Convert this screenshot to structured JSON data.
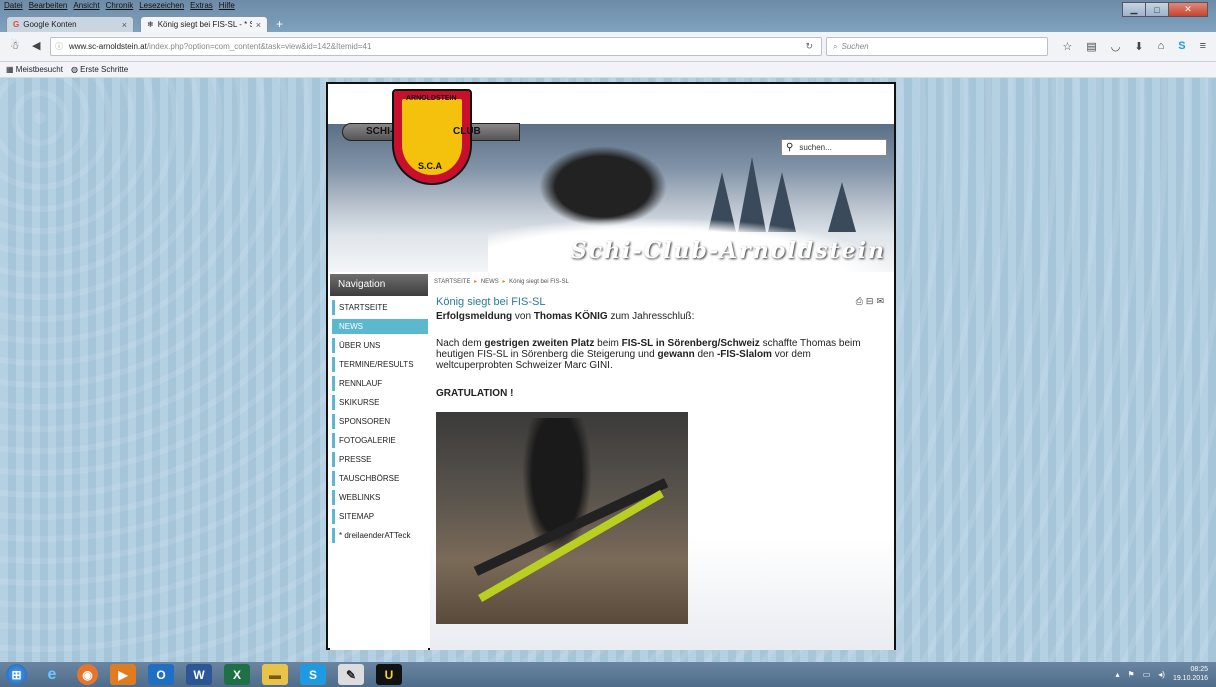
{
  "browser": {
    "menu": [
      "Datei",
      "Bearbeiten",
      "Ansicht",
      "Chronik",
      "Lesezeichen",
      "Extras",
      "Hilfe"
    ],
    "tabs": [
      {
        "label": "Google Konten",
        "active": false
      },
      {
        "label": "König siegt bei FIS-SL - * S...",
        "active": true
      }
    ],
    "new_tab": "+",
    "url": {
      "host": "www.sc-arnoldstein.at",
      "path": "/index.php?option=com_content&task=view&id=142&Itemid=41"
    },
    "search_placeholder": "Suchen",
    "bookmarks": [
      "Meistbesucht",
      "Erste Schritte"
    ],
    "toolbar_icons": [
      "star-icon",
      "reading-list-icon",
      "pocket-icon",
      "download-icon",
      "home-icon",
      "skype-icon",
      "menu-icon"
    ]
  },
  "site": {
    "logo": {
      "top": "ARNOLDSTEIN",
      "left": "SCHI-",
      "right": "CLUB",
      "bottom": "S.C.A"
    },
    "banner_title": "Schi-Club-Arnoldstein",
    "search_placeholder": "suchen...",
    "nav": {
      "heading": "Navigation",
      "items": [
        {
          "label": "STARTSEITE",
          "active": false
        },
        {
          "label": "NEWS",
          "active": true
        },
        {
          "label": "ÜBER UNS",
          "active": false
        },
        {
          "label": "TERMINE/RESULTS",
          "active": false
        },
        {
          "label": "RENNLAUF",
          "active": false
        },
        {
          "label": "SKIKURSE",
          "active": false
        },
        {
          "label": "SPONSOREN",
          "active": false
        },
        {
          "label": "FOTOGALERIE",
          "active": false
        },
        {
          "label": "PRESSE",
          "active": false
        },
        {
          "label": "TAUSCHBÖRSE",
          "active": false
        },
        {
          "label": "WEBLINKS",
          "active": false
        },
        {
          "label": "SITEMAP",
          "active": false
        },
        {
          "label": "* dreilaenderATTeck",
          "active": false
        }
      ]
    },
    "breadcrumb": [
      "STARTSEITE",
      "NEWS",
      "König siegt bei FIS-SL"
    ],
    "article": {
      "title": "König siegt bei FIS-SL",
      "lead": {
        "p1": "Erfolgsmeldung",
        "p2": " von ",
        "p3": "Thomas KÖNIG",
        "p4": " zum Jahresschluß:"
      },
      "body": {
        "t1": "Nach dem ",
        "b1": "gestrigen zweiten Platz",
        "t2": " beim ",
        "b2": "FIS-SL in Sörenberg/Schweiz",
        "t3": " schaffte Thomas beim heutigen FIS-SL in Sörenberg die Steigerung und ",
        "b3": "gewann",
        "t4": " den ",
        "b4": "-FIS-Slalom",
        "t5": " vor dem weltcuperprobten Schweizer Marc GINI."
      },
      "congrats": "GRATULATION !"
    }
  },
  "taskbar": {
    "clock_time": "08:25",
    "clock_date": "19.10.2016"
  }
}
